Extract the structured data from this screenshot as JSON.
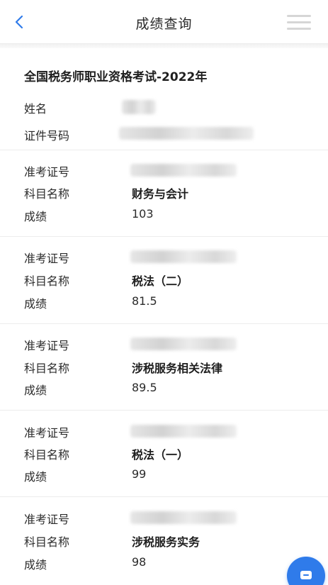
{
  "header": {
    "title": "成绩查询",
    "back_icon": "chevron-left-icon",
    "menu_icon": "hamburger-menu-icon"
  },
  "exam": {
    "title": "全国税务师职业资格考试-2022年",
    "name_label": "姓名",
    "id_label": "证件号码"
  },
  "subjects": [
    {
      "ticket_label": "准考证号",
      "subject_label": "科目名称",
      "subject": "财务与会计",
      "score_label": "成绩",
      "score": "103"
    },
    {
      "ticket_label": "准考证号",
      "subject_label": "科目名称",
      "subject": "税法（二）",
      "score_label": "成绩",
      "score": "81.5"
    },
    {
      "ticket_label": "准考证号",
      "subject_label": "科目名称",
      "subject": "涉税服务相关法律",
      "score_label": "成绩",
      "score": "89.5"
    },
    {
      "ticket_label": "准考证号",
      "subject_label": "科目名称",
      "subject": "税法（一）",
      "score_label": "成绩",
      "score": "99"
    },
    {
      "ticket_label": "准考证号",
      "subject_label": "科目名称",
      "subject": "涉税服务实务",
      "score_label": "成绩",
      "score": "98"
    }
  ],
  "colors": {
    "accent": "#2f7bea",
    "divider": "#ececec"
  },
  "fab_icon": "chat-icon"
}
